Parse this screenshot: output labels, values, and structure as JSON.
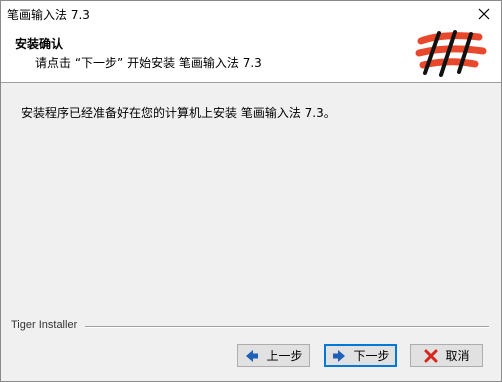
{
  "window": {
    "title": "笔画输入法 7.3"
  },
  "header": {
    "title": "安装确认",
    "subtitle": "请点击 “下一步” 开始安装 笔画输入法 7.3"
  },
  "body": {
    "message": "安装程序已经准备好在您的计算机上安装 笔画输入法 7.3。"
  },
  "footer": {
    "installer_label": "Tiger Installer"
  },
  "buttons": {
    "back_label": "上一步",
    "next_label": "下一步",
    "cancel_label": "取消"
  },
  "colors": {
    "logo_red": "#e8492c",
    "logo_black": "#111111",
    "arrow_blue": "#1e5fb8",
    "cancel_red": "#d8261c",
    "default_button_border": "#0078d7"
  }
}
